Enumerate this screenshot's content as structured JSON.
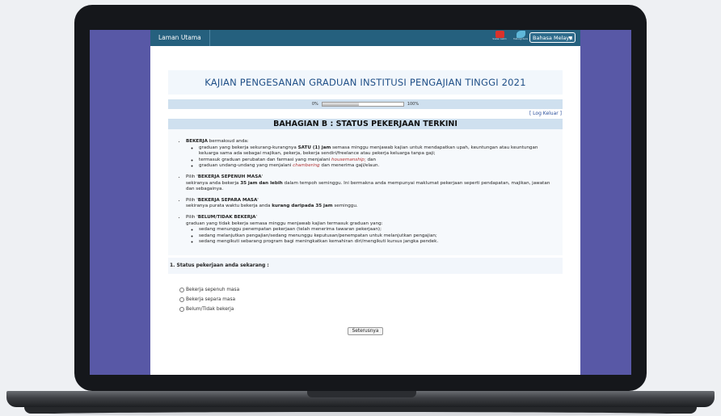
{
  "topbar": {
    "home_label": "Laman Utama",
    "icons": [
      {
        "name": "faq-icon",
        "caption": "Soalan Lazim",
        "color": "#d9322c"
      },
      {
        "name": "phone-icon",
        "caption": "Hubungi Kami",
        "color": "#5fb7d9"
      }
    ],
    "language": "Bahasa Melayu"
  },
  "survey": {
    "title": "KAJIAN PENGESANAN GRADUAN INSTITUSI PENGAJIAN TINGGI 2021",
    "progress": {
      "start_label": "0%",
      "end_label": "100%",
      "fraction": 0.45
    },
    "logout_label": "[ Log Keluar ]",
    "section_title": "BAHAGIAN B : STATUS PEKERJAAN TERKINI"
  },
  "guidance": {
    "b1_bold": "BEKERJA",
    "b1_text": " bermaksud anda:",
    "b1_sub1_a": "graduan yang bekerja sekurang-kurangnya ",
    "b1_sub1_bold": "SATU (1) jam",
    "b1_sub1_b": " semasa minggu menjawab kajian untuk mendapatkan upah, keuntungan atau keuntungan keluarga sama ada sebagai majikan, pekerja, bekerja sendiri/freelance atau pekerja keluarga tanpa gaji;",
    "b1_sub2_a": "termasuk graduan perubatan dan farmasi yang menjalani ",
    "b1_sub2_it": "housemanship;",
    "b1_sub2_b": " dan",
    "b1_sub3_a": "graduan undang-undang yang menjalani ",
    "b1_sub3_it": "chambering",
    "b1_sub3_b": " dan menerima gaji/elaun.",
    "b2_a": "Pilih '",
    "b2_bold": "BEKERJA SEPENUH MASA",
    "b2_b": "'",
    "b2_desc_a": "sekiranya anda bekerja ",
    "b2_desc_bold": "35 jam dan lebih",
    "b2_desc_b": " dalam tempoh seminggu. Ini bermakna anda mempunyai maklumat pekerjaan seperti pendapatan, majikan, jawatan dan sebagainya.",
    "b3_a": "Pilih '",
    "b3_bold": "BEKERJA SEPARA MASA",
    "b3_b": "'",
    "b3_desc_a": "sekiranya purata waktu bekerja anda ",
    "b3_desc_bold": "kurang daripada 35 jam",
    "b3_desc_b": " seminggu.",
    "b4_a": "Pilih '",
    "b4_bold": "BELUM/TIDAK BEKERJA",
    "b4_b": "'",
    "b4_desc": "graduan yang tidak bekerja semasa minggu menjawab kajian termasuk graduan yang:",
    "b4_sub1": "sedang menunggu penempatan pekerjaan (telah menerima tawaran pekerjaan);",
    "b4_sub2": "sedang melanjutkan pengajian/sedang menunggu keputusan/penempatan untuk melanjutkan pengajian;",
    "b4_sub3": "sedang mengikuti sebarang program bagi meningkatkan kemahiran diri/mengikuti kursus jangka pendek."
  },
  "question": {
    "label": "1. Status pekerjaan anda sekarang :",
    "options": [
      "Bekerja sepenuh masa",
      "Bekerja separa masa",
      "Belum/Tidak bekerja"
    ],
    "next_label": "Seterusnya"
  }
}
